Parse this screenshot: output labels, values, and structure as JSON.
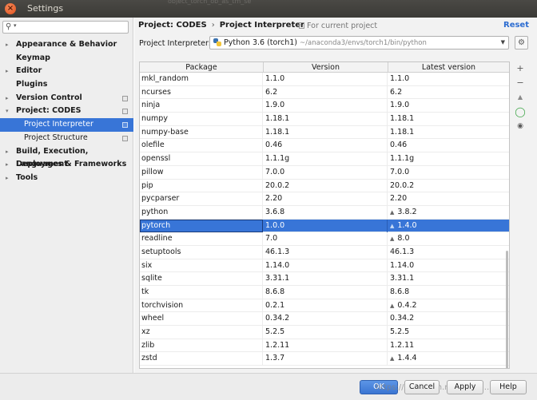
{
  "window": {
    "title": "Settings",
    "title_ghost_text": "object_torch_ob_as_tm_se"
  },
  "sidebar": {
    "search_placeholder": "",
    "items": [
      {
        "label": "Appearance & Behavior",
        "arrow": "▸",
        "copy": false
      },
      {
        "label": "Keymap",
        "arrow": "",
        "copy": false
      },
      {
        "label": "Editor",
        "arrow": "▸",
        "copy": false
      },
      {
        "label": "Plugins",
        "arrow": "",
        "copy": false
      },
      {
        "label": "Version Control",
        "arrow": "▸",
        "copy": true
      },
      {
        "label": "Project: CODES",
        "arrow": "▾",
        "copy": true
      },
      {
        "label": "Project Interpreter",
        "arrow": "",
        "copy": true,
        "sub": true,
        "selected": true
      },
      {
        "label": "Project Structure",
        "arrow": "",
        "copy": true,
        "sub": true
      },
      {
        "label": "Build, Execution, Deployment",
        "arrow": "▸",
        "copy": false
      },
      {
        "label": "Languages & Frameworks",
        "arrow": "▸",
        "copy": false
      },
      {
        "label": "Tools",
        "arrow": "▸",
        "copy": false
      }
    ]
  },
  "header": {
    "breadcrumb_project": "Project: CODES",
    "breadcrumb_separator": "›",
    "breadcrumb_page": "Project Interpreter",
    "for_current_project": "For current project",
    "reset": "Reset"
  },
  "interpreter": {
    "label": "Project Interpreter:",
    "name": "Python 3.6 (torch1)",
    "path": "~/anaconda3/envs/torch1/bin/python"
  },
  "packages": {
    "columns": [
      "Package",
      "Version",
      "Latest version"
    ],
    "rows": [
      {
        "name": "mkl_random",
        "version": "1.1.0",
        "latest": "1.1.0",
        "upgrade": false
      },
      {
        "name": "ncurses",
        "version": "6.2",
        "latest": "6.2",
        "upgrade": false
      },
      {
        "name": "ninja",
        "version": "1.9.0",
        "latest": "1.9.0",
        "upgrade": false
      },
      {
        "name": "numpy",
        "version": "1.18.1",
        "latest": "1.18.1",
        "upgrade": false
      },
      {
        "name": "numpy-base",
        "version": "1.18.1",
        "latest": "1.18.1",
        "upgrade": false
      },
      {
        "name": "olefile",
        "version": "0.46",
        "latest": "0.46",
        "upgrade": false
      },
      {
        "name": "openssl",
        "version": "1.1.1g",
        "latest": "1.1.1g",
        "upgrade": false
      },
      {
        "name": "pillow",
        "version": "7.0.0",
        "latest": "7.0.0",
        "upgrade": false
      },
      {
        "name": "pip",
        "version": "20.0.2",
        "latest": "20.0.2",
        "upgrade": false
      },
      {
        "name": "pycparser",
        "version": "2.20",
        "latest": "2.20",
        "upgrade": false
      },
      {
        "name": "python",
        "version": "3.6.8",
        "latest": "3.8.2",
        "upgrade": true
      },
      {
        "name": "pytorch",
        "version": "1.0.0",
        "latest": "1.4.0",
        "upgrade": true,
        "selected": true
      },
      {
        "name": "readline",
        "version": "7.0",
        "latest": "8.0",
        "upgrade": true
      },
      {
        "name": "setuptools",
        "version": "46.1.3",
        "latest": "46.1.3",
        "upgrade": false
      },
      {
        "name": "six",
        "version": "1.14.0",
        "latest": "1.14.0",
        "upgrade": false
      },
      {
        "name": "sqlite",
        "version": "3.31.1",
        "latest": "3.31.1",
        "upgrade": false
      },
      {
        "name": "tk",
        "version": "8.6.8",
        "latest": "8.6.8",
        "upgrade": false
      },
      {
        "name": "torchvision",
        "version": "0.2.1",
        "latest": "0.4.2",
        "upgrade": true
      },
      {
        "name": "wheel",
        "version": "0.34.2",
        "latest": "0.34.2",
        "upgrade": false
      },
      {
        "name": "xz",
        "version": "5.2.5",
        "latest": "5.2.5",
        "upgrade": false
      },
      {
        "name": "zlib",
        "version": "1.2.11",
        "latest": "1.2.11",
        "upgrade": false
      },
      {
        "name": "zstd",
        "version": "1.3.7",
        "latest": "1.4.4",
        "upgrade": true
      }
    ]
  },
  "tools": {
    "add": "+",
    "remove": "−",
    "upgrade": "▲",
    "loading": "◯",
    "show_early": "◉"
  },
  "footer": {
    "ok": "OK",
    "cancel": "Cancel",
    "apply": "Apply",
    "help": "Help",
    "watermark": "https://blog.csdn.net/qq_35..."
  },
  "colors": {
    "selection": "#3875d7",
    "link": "#2d6dd1",
    "title_bar": "#3b3a36",
    "close_button": "#e1501c"
  }
}
